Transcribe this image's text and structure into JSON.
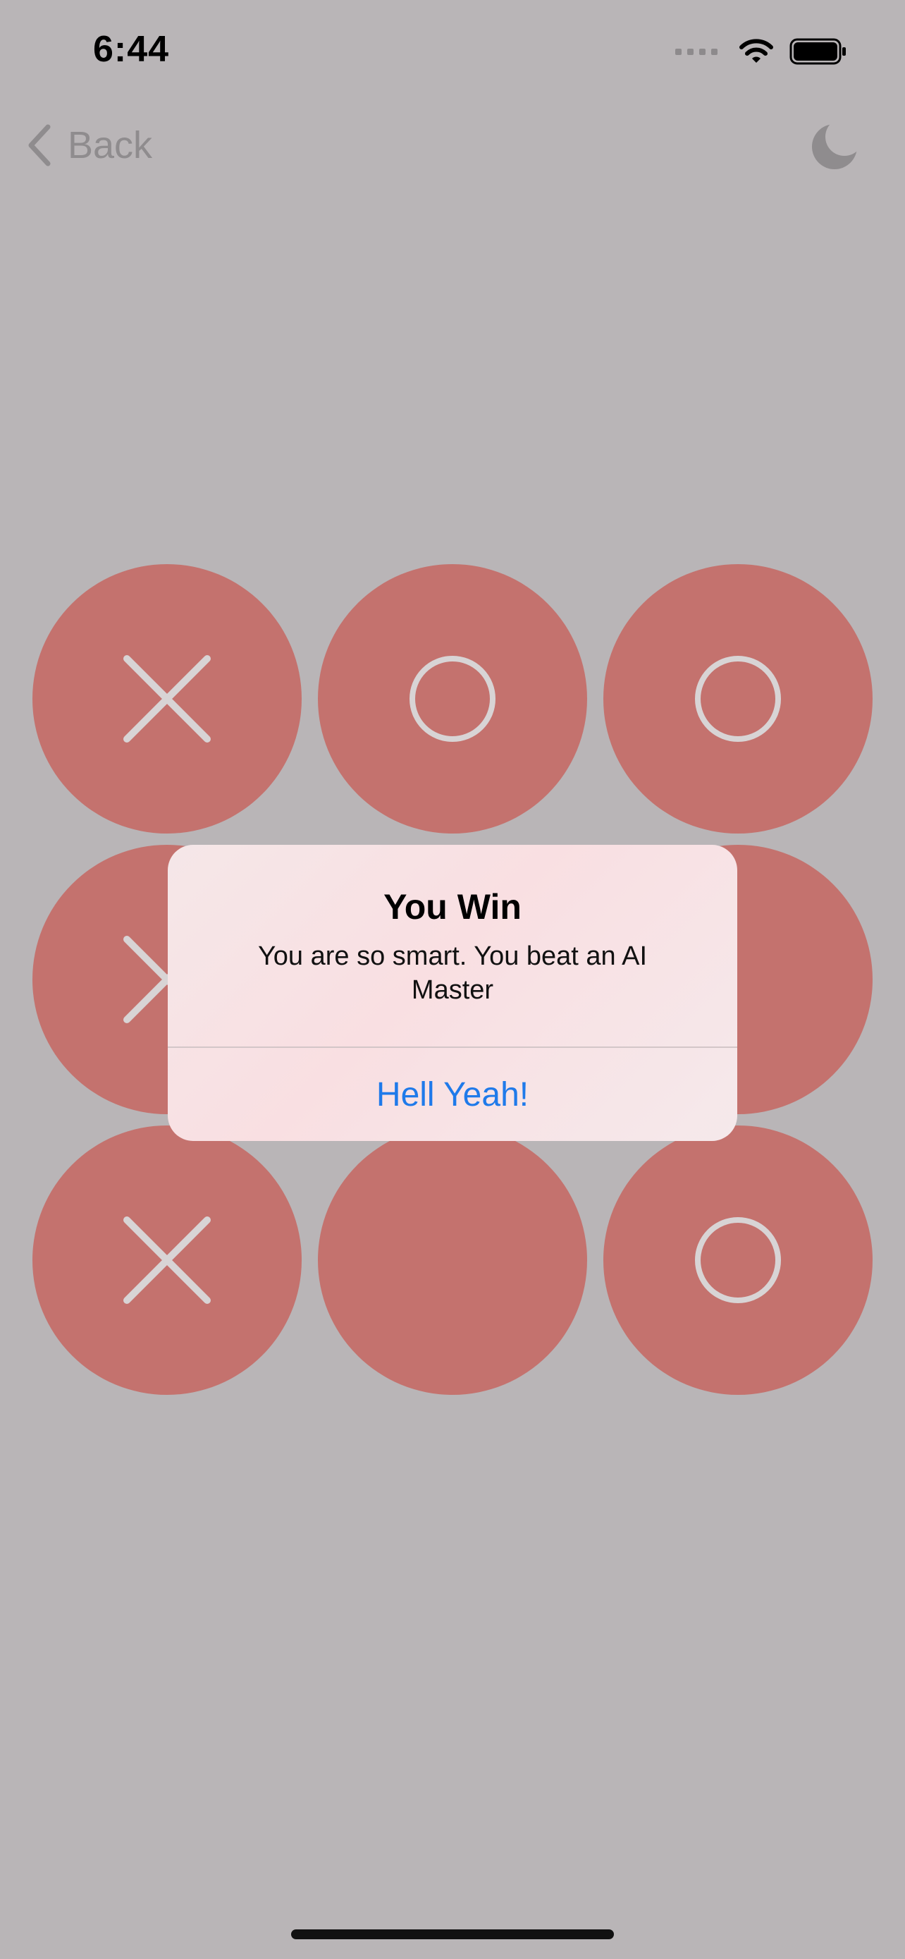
{
  "status_bar": {
    "time": "6:44"
  },
  "nav": {
    "back_label": "Back",
    "back_icon": "chevron-left-icon",
    "theme_icon": "moon-icon"
  },
  "board": {
    "cells": [
      "X",
      "O",
      "O",
      "X",
      "",
      "",
      "X",
      "",
      "O"
    ]
  },
  "alert": {
    "title": "You Win",
    "message": "You are so smart. You beat an AI Master",
    "action_label": "Hell Yeah!"
  },
  "colors": {
    "background": "#b9b5b7",
    "cell": "#c4726e",
    "mark": "#d8d4d5",
    "accent": "#1f7aea"
  }
}
